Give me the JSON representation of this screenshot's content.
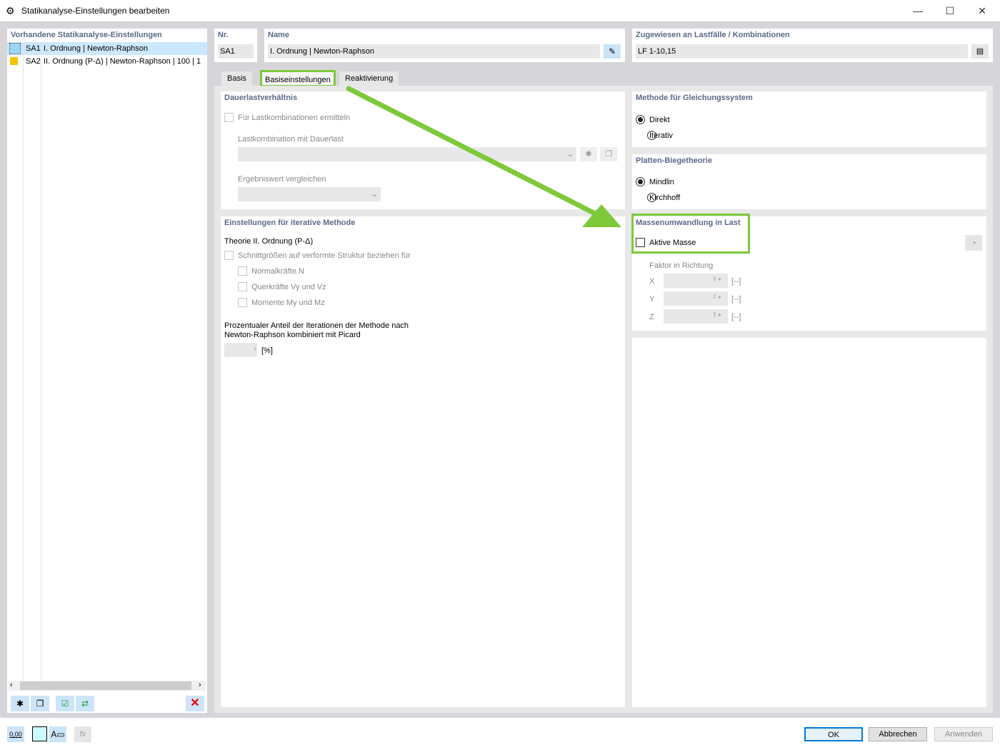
{
  "window": {
    "title": "Statikanalyse-Einstellungen bearbeiten",
    "minimize": "—",
    "maximize": "☐",
    "close": "✕"
  },
  "left": {
    "header": "Vorhandene Statikanalyse-Einstellungen",
    "items": [
      {
        "id": "SA1",
        "label": "I. Ordnung | Newton-Raphson",
        "color": "#9dd5f5",
        "selected": true
      },
      {
        "id": "SA2",
        "label": "II. Ordnung (P-Δ) | Newton-Raphson | 100 | 1",
        "color": "#f5c400",
        "selected": false
      }
    ]
  },
  "top": {
    "nr_label": "Nr.",
    "nr_value": "SA1",
    "name_label": "Name",
    "name_value": "I. Ordnung | Newton-Raphson",
    "assigned_label": "Zugewiesen an Lastfälle / Kombinationen",
    "assigned_value": "LF 1-10,15"
  },
  "tabs": [
    {
      "label": "Basis"
    },
    {
      "label": "Basiseinstellungen",
      "active": true
    },
    {
      "label": "Reaktivierung"
    }
  ],
  "dauer": {
    "header": "Dauerlastverhältnis",
    "check": "Für Lastkombinationen ermitteln",
    "combo_label": "Lastkombination mit Dauerlast",
    "compare_label": "Ergebniswert vergleichen"
  },
  "iter": {
    "header": "Einstellungen für iterative Methode",
    "theory": "Theorie II. Ordnung (P-Δ)",
    "check_main": "Schnittgrößen auf verformte Struktur beziehen für",
    "check_n": "Normalkräfte N",
    "check_v": "Querkräfte Vy und Vz",
    "check_m": "Momente My und Mz",
    "percent_text1": "Prozentualer Anteil der Iterationen der Methode nach",
    "percent_text2": "Newton-Raphson kombiniert mit Picard",
    "percent_unit": "[%]"
  },
  "method": {
    "header": "Methode für Gleichungssystem",
    "options": [
      "Direkt",
      "Iterativ"
    ],
    "selected": "Direkt"
  },
  "plate": {
    "header": "Platten-Biegetheorie",
    "options": [
      "Mindlin",
      "Kirchhoff"
    ],
    "selected": "Mindlin"
  },
  "mass": {
    "header": "Massenumwandlung in Last",
    "check": "Aktive Masse",
    "checked": false,
    "factor_label": "Faktor in Richtung",
    "axes": [
      "X",
      "Y",
      "Z"
    ],
    "unit": "[--]"
  },
  "footer": {
    "ok": "OK",
    "cancel": "Abbrechen",
    "apply": "Anwenden",
    "decimal_icon_text": "0,00"
  },
  "colors": {
    "highlight": "#7dc93a",
    "header_text": "#5a6a8a",
    "selection": "#cce8ff"
  }
}
